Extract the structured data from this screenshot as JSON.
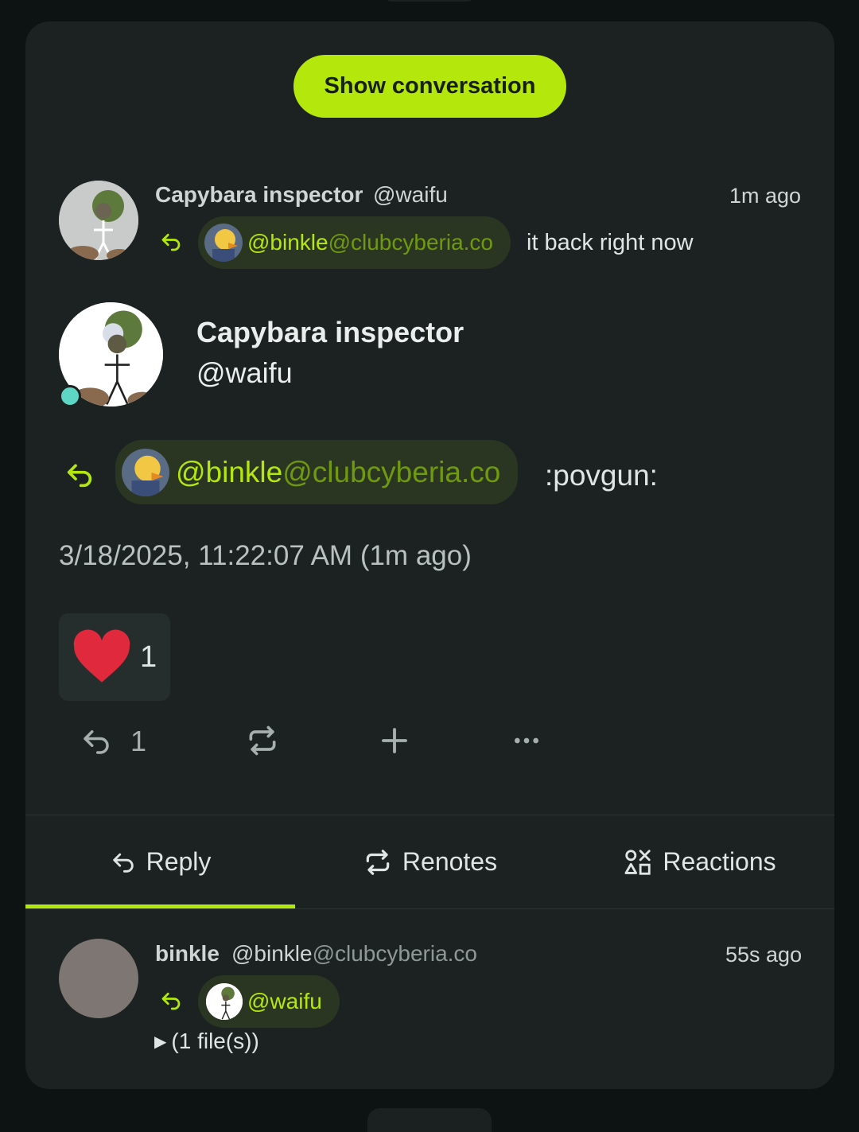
{
  "conversation_button": "Show conversation",
  "parent_note": {
    "display_name": "Capybara inspector",
    "username": "@waifu",
    "time": "1m ago",
    "mention_user": "@binkle",
    "mention_host": "@clubcyberia.co",
    "text": "it back right now"
  },
  "main_note": {
    "display_name": "Capybara inspector",
    "username": "@waifu",
    "mention_user": "@binkle",
    "mention_host": "@clubcyberia.co",
    "text": ":povgun:",
    "timestamp": "3/18/2025, 11:22:07 AM (1m ago)",
    "reaction": {
      "emoji": "heart",
      "count": "1"
    },
    "reply_count": "1"
  },
  "tabs": [
    {
      "label": "Reply",
      "icon": "reply-icon"
    },
    {
      "label": "Renotes",
      "icon": "repeat-icon"
    },
    {
      "label": "Reactions",
      "icon": "shapes-icon"
    }
  ],
  "reply_note": {
    "display_name": "binkle",
    "username": "@binkle",
    "host": "@clubcyberia.co",
    "time": "55s ago",
    "mention": "@waifu",
    "files": "(1 file(s))"
  },
  "colors": {
    "accent": "#b4e80c",
    "card": "#1b2221",
    "background": "#0d1212",
    "online": "#5ed6c6",
    "heart": "#e0293c"
  }
}
